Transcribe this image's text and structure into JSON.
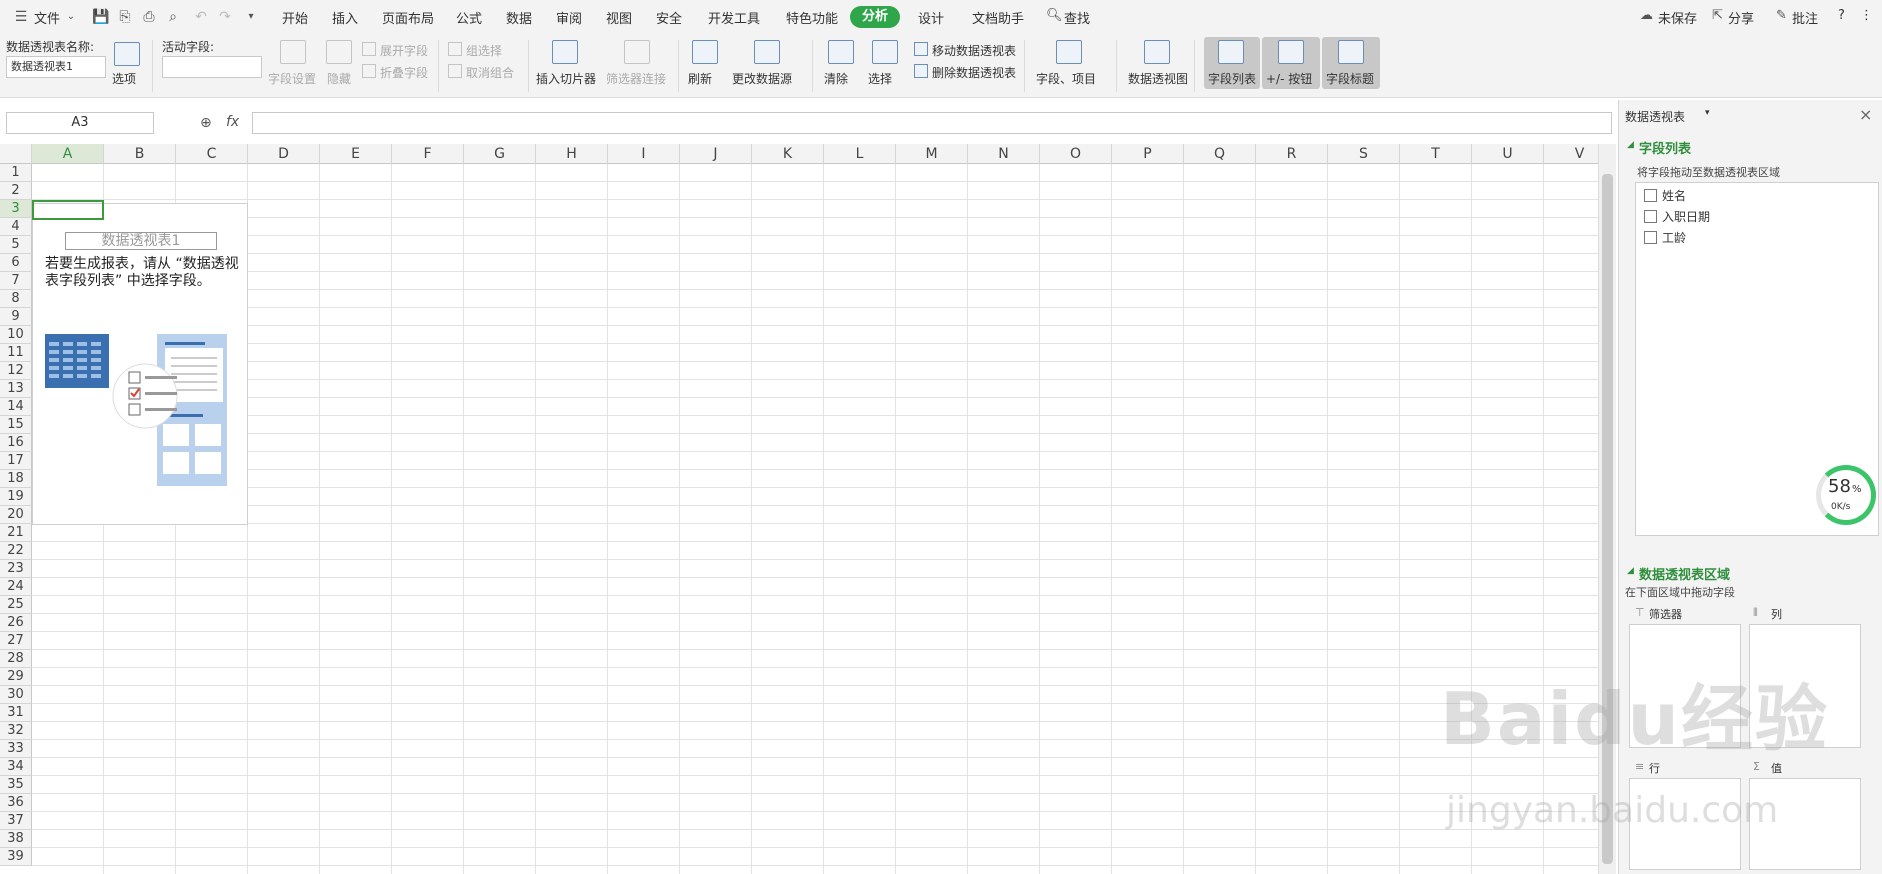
{
  "menubar": {
    "file_label": "文件",
    "tabs": [
      "开始",
      "插入",
      "页面布局",
      "公式",
      "数据",
      "审阅",
      "视图",
      "安全",
      "开发工具",
      "特色功能",
      "分析",
      "设计",
      "文档助手"
    ],
    "active_tab": "分析",
    "search_label": "查找",
    "unsaved_label": "未保存",
    "share_label": "分享",
    "comment_label": "批注",
    "help_label": "?"
  },
  "ribbon": {
    "pivot_name_label": "数据透视表名称:",
    "pivot_name_value": "数据透视表1",
    "options_label": "选项",
    "active_field_label": "活动字段:",
    "field_settings_label": "字段设置",
    "hide_label": "隐藏",
    "expand_field_label": "展开字段",
    "collapse_field_label": "折叠字段",
    "group_selection_label": "组选择",
    "ungroup_label": "取消组合",
    "insert_slicer_label": "插入切片器",
    "filter_connection_label": "筛选器连接",
    "refresh_label": "刷新",
    "change_source_label": "更改数据源",
    "clear_label": "清除",
    "select_label": "选择",
    "move_pivot_label": "移动数据透视表",
    "delete_pivot_label": "删除数据透视表",
    "fields_items_label": "字段、项目",
    "pivot_chart_label": "数据透视图",
    "field_list_label": "字段列表",
    "buttons_label": "+/- 按钮",
    "field_headers_label": "字段标题"
  },
  "formula_bar": {
    "name_box": "A3",
    "fx_label": "fx"
  },
  "grid": {
    "columns": [
      "A",
      "B",
      "C",
      "D",
      "E",
      "F",
      "G",
      "H",
      "I",
      "J",
      "K",
      "L",
      "M",
      "N",
      "O",
      "P",
      "Q",
      "R",
      "S",
      "T",
      "U",
      "V"
    ],
    "rows": [
      "1",
      "2",
      "3",
      "4",
      "5",
      "6",
      "7",
      "8",
      "9",
      "10",
      "11",
      "12",
      "13",
      "14",
      "15",
      "16",
      "17",
      "18",
      "19",
      "20",
      "21",
      "22",
      "23",
      "24",
      "25",
      "26",
      "27",
      "28",
      "29",
      "30",
      "31",
      "32",
      "33",
      "34",
      "35",
      "36",
      "37",
      "38",
      "39"
    ]
  },
  "pivot_placeholder": {
    "title": "数据透视表1",
    "text": "若要生成报表，请从 “数据透视表字段列表” 中选择字段。"
  },
  "panel": {
    "title": "数据透视表",
    "field_list_heading": "字段列表",
    "field_list_hint": "将字段拖动至数据透视表区域",
    "fields": [
      "姓名",
      "入职日期",
      "工龄"
    ],
    "area_heading": "数据透视表区域",
    "area_hint": "在下面区域中拖动字段",
    "filter_label": "筛选器",
    "column_label": "列",
    "row_label": "行",
    "value_label": "值"
  },
  "speed_widget": {
    "percent": "58",
    "percent_sign": "%",
    "speed": "0K/s"
  },
  "watermark": {
    "brand": "Baidu经验",
    "url": "jingyan.baidu.com"
  }
}
